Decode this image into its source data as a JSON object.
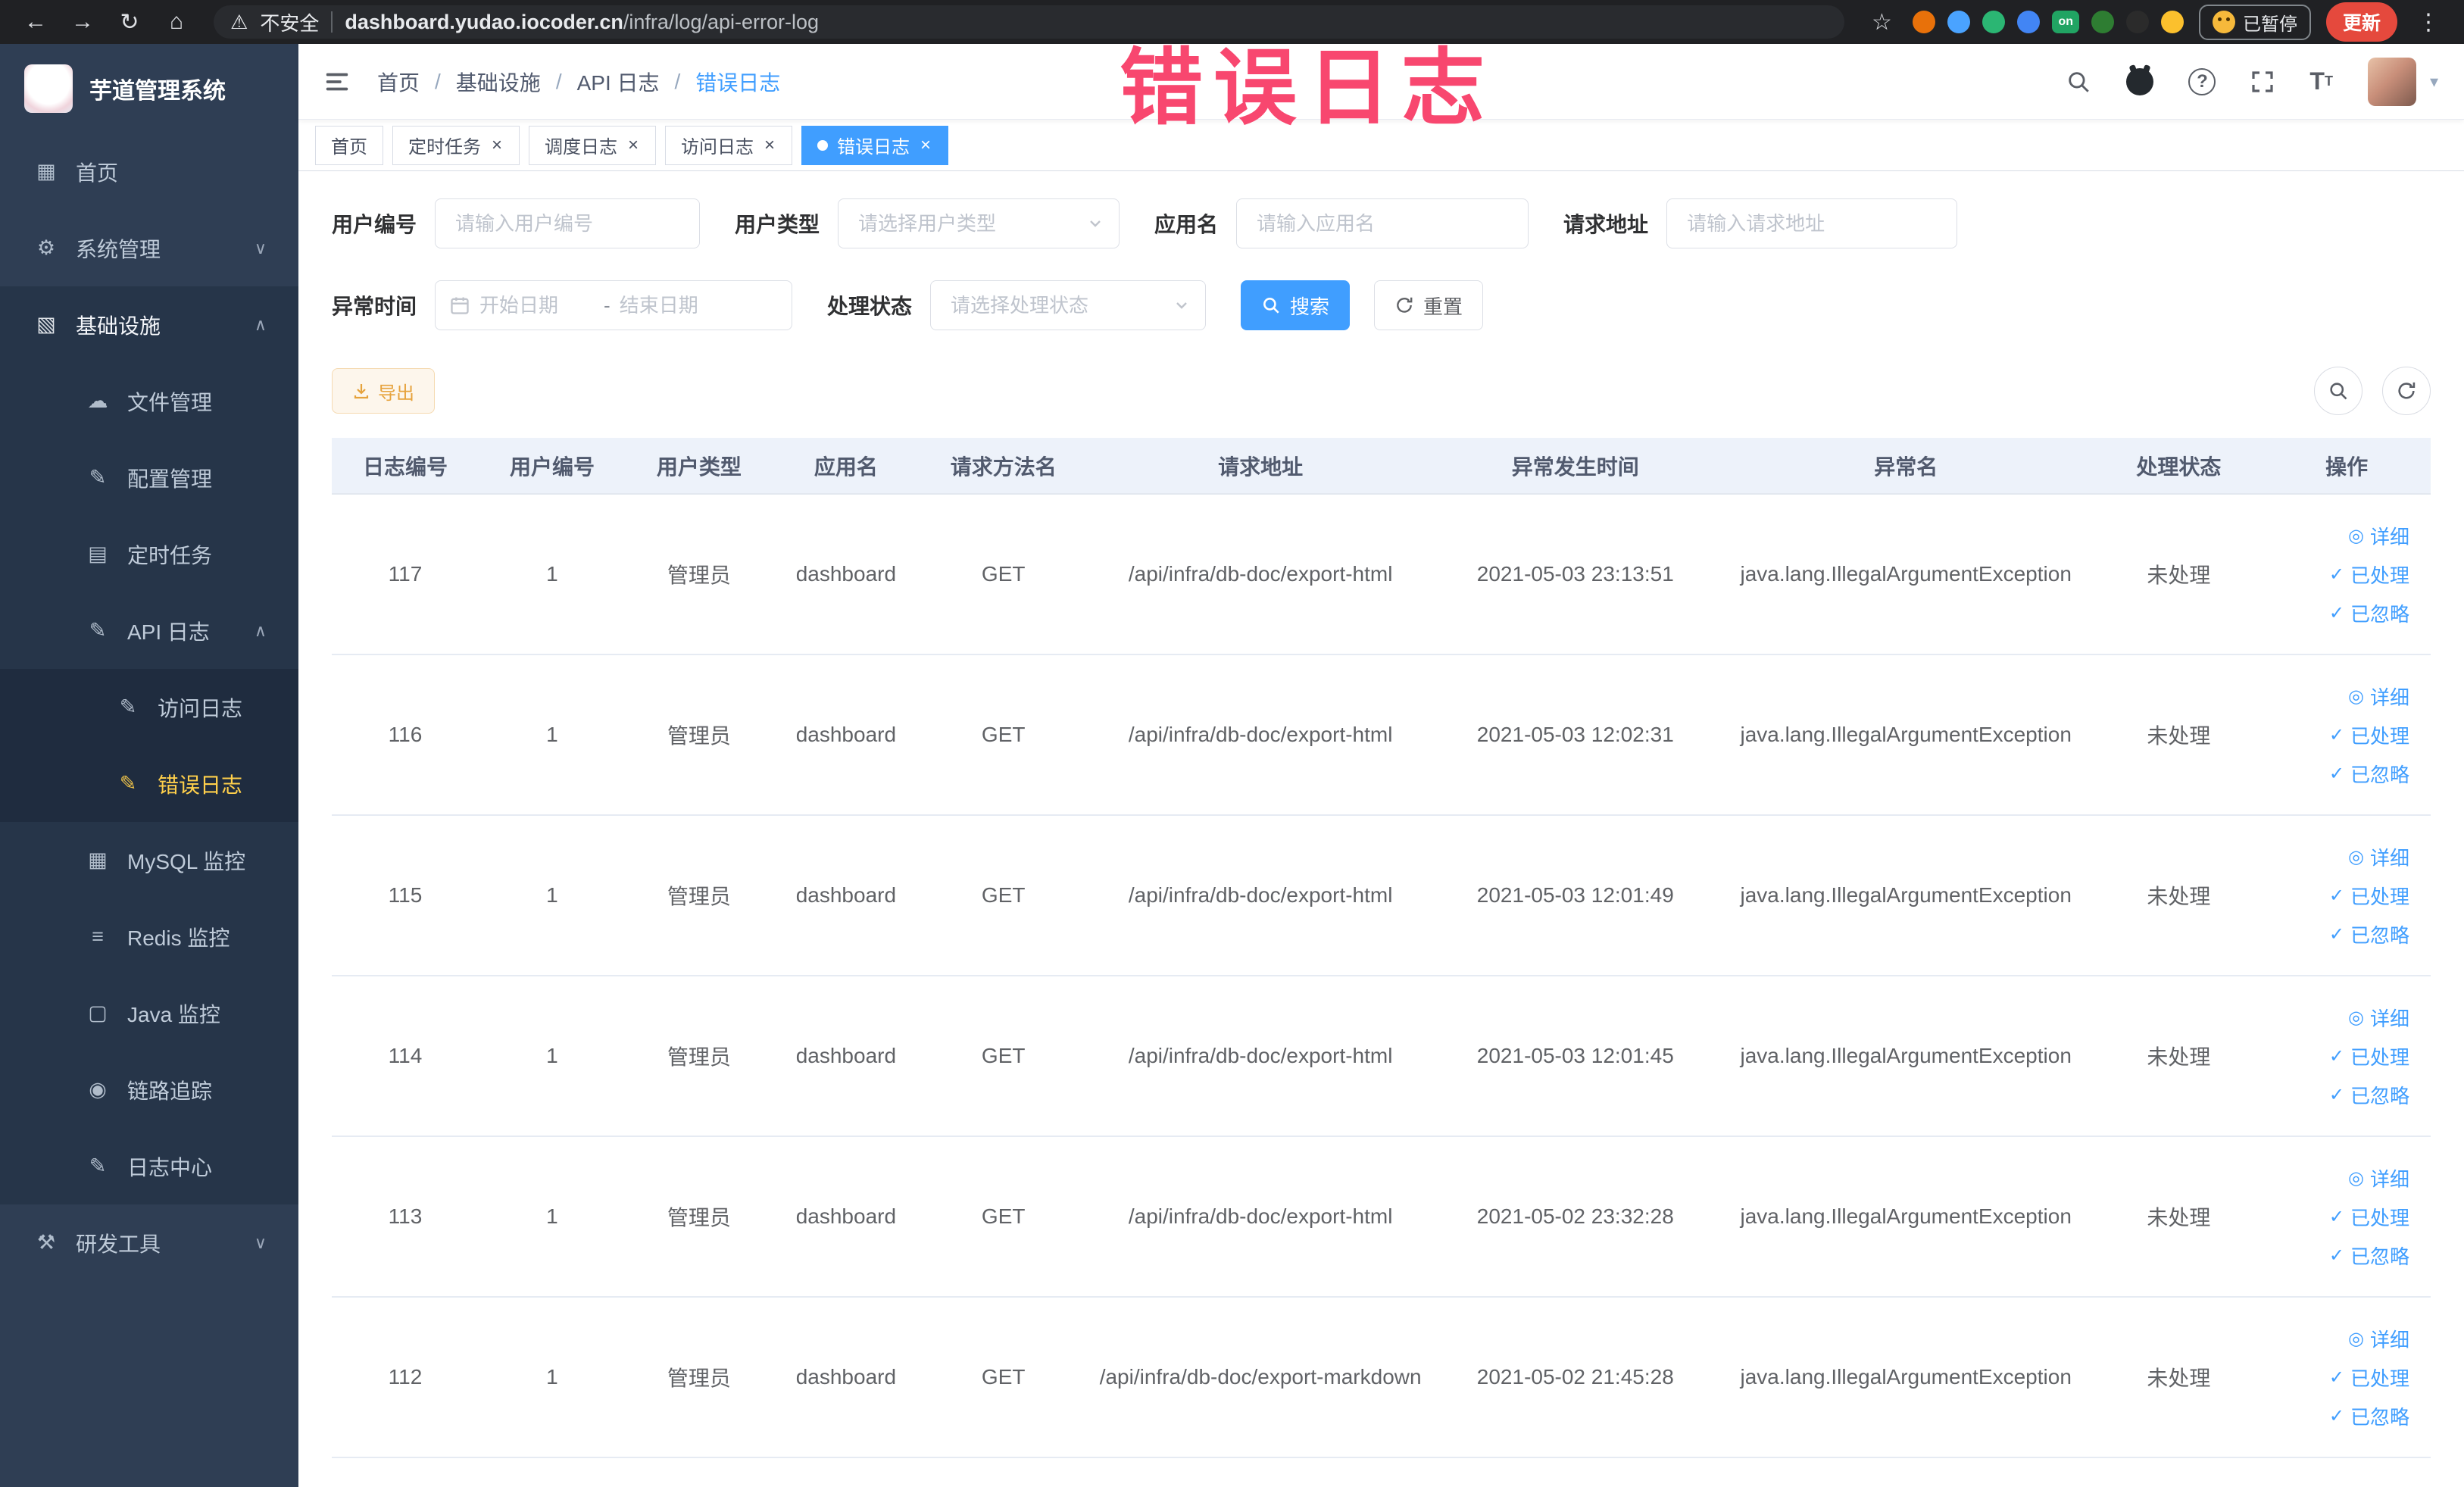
{
  "browser": {
    "security_label": "不安全",
    "url_domain": "dashboard.yudao.iocoder.cn",
    "url_path": "/infra/log/api-error-log",
    "paused_badge": "已暂停",
    "update_button": "更新",
    "icons": {
      "back": "←",
      "forward": "→",
      "reload": "↻",
      "home": "⌂",
      "warning": "⚠",
      "star": "☆",
      "menu": "⋮"
    },
    "extensions": [
      {
        "name": "extension-orange-icon",
        "color": "#e8710a"
      },
      {
        "name": "extension-drop-icon",
        "color": "#4aa3ff"
      },
      {
        "name": "extension-green-circle-icon",
        "color": "#2bb673"
      },
      {
        "name": "extension-blue-grid-icon",
        "color": "#4285f4"
      },
      {
        "name": "extension-on-badge-icon",
        "color": "#21a463",
        "label": "on"
      },
      {
        "name": "extension-tree-icon",
        "color": "#2e7d32"
      },
      {
        "name": "extension-paw-icon",
        "color": "#2b2b2b"
      },
      {
        "name": "extension-smiley-icon",
        "color": "#fbc02d"
      }
    ]
  },
  "overlay": {
    "title": "错误日志"
  },
  "sidebar": {
    "logo_title": "芋道管理系统",
    "items": [
      {
        "id": "home",
        "label": "首页",
        "icon": "dashboard-icon",
        "glyph": "▦",
        "level": 1
      },
      {
        "id": "system-management",
        "label": "系统管理",
        "icon": "gear-icon",
        "glyph": "⚙",
        "level": 1,
        "chevron": "down"
      },
      {
        "id": "infrastructure",
        "label": "基础设施",
        "icon": "infra-icon",
        "glyph": "▧",
        "level": 1,
        "chevron": "up",
        "expanded": true
      },
      {
        "id": "file-management",
        "label": "文件管理",
        "icon": "cloud-icon",
        "glyph": "☁",
        "level": 2
      },
      {
        "id": "config-management",
        "label": "配置管理",
        "icon": "edit-icon",
        "glyph": "✎",
        "level": 2
      },
      {
        "id": "scheduled-tasks",
        "label": "定时任务",
        "icon": "list-icon",
        "glyph": "▤",
        "level": 2
      },
      {
        "id": "api-log",
        "label": "API 日志",
        "icon": "edit-square-icon",
        "glyph": "✎",
        "level": 2,
        "chevron": "up"
      },
      {
        "id": "access-log",
        "label": "访问日志",
        "icon": "edit-square-icon",
        "glyph": "✎",
        "level": 3
      },
      {
        "id": "error-log",
        "label": "错误日志",
        "icon": "edit-square-icon",
        "glyph": "✎",
        "level": 3,
        "active": true
      },
      {
        "id": "mysql-monitor",
        "label": "MySQL 监控",
        "icon": "grid-icon",
        "glyph": "▦",
        "level": 2
      },
      {
        "id": "redis-monitor",
        "label": "Redis 监控",
        "icon": "layers-icon",
        "glyph": "≡",
        "level": 2
      },
      {
        "id": "java-monitor",
        "label": "Java 监控",
        "icon": "monitor-icon",
        "glyph": "▢",
        "level": 2
      },
      {
        "id": "trace",
        "label": "链路追踪",
        "icon": "eye-icon",
        "glyph": "◉",
        "level": 2
      },
      {
        "id": "log-center",
        "label": "日志中心",
        "icon": "edit-square-icon",
        "glyph": "✎",
        "level": 2
      },
      {
        "id": "dev-tools",
        "label": "研发工具",
        "icon": "tools-icon",
        "glyph": "⚒",
        "level": 1,
        "chevron": "down"
      }
    ]
  },
  "breadcrumb": [
    "首页",
    "基础设施",
    "API 日志",
    "错误日志"
  ],
  "tabs": [
    {
      "id": "home",
      "label": "首页",
      "closable": false,
      "active": false
    },
    {
      "id": "scheduled-tasks",
      "label": "定时任务",
      "closable": true,
      "active": false
    },
    {
      "id": "dispatch-log",
      "label": "调度日志",
      "closable": true,
      "active": false
    },
    {
      "id": "access-log",
      "label": "访问日志",
      "closable": true,
      "active": false
    },
    {
      "id": "error-log",
      "label": "错误日志",
      "closable": true,
      "active": true
    }
  ],
  "filters": {
    "user_id": {
      "label": "用户编号",
      "placeholder": "请输入用户编号"
    },
    "user_type": {
      "label": "用户类型",
      "placeholder": "请选择用户类型"
    },
    "app_name": {
      "label": "应用名",
      "placeholder": "请输入应用名"
    },
    "request_url": {
      "label": "请求地址",
      "placeholder": "请输入请求地址"
    },
    "exception_time": {
      "label": "异常时间",
      "start_placeholder": "开始日期",
      "end_placeholder": "结束日期",
      "separator": "-"
    },
    "process_status": {
      "label": "处理状态",
      "placeholder": "请选择处理状态"
    },
    "search_label": "搜索",
    "reset_label": "重置"
  },
  "toolbar": {
    "export_label": "导出"
  },
  "table": {
    "columns": [
      {
        "key": "id",
        "label": "日志编号"
      },
      {
        "key": "user_id",
        "label": "用户编号"
      },
      {
        "key": "user_type",
        "label": "用户类型"
      },
      {
        "key": "app",
        "label": "应用名"
      },
      {
        "key": "method",
        "label": "请求方法名"
      },
      {
        "key": "url",
        "label": "请求地址"
      },
      {
        "key": "time",
        "label": "异常发生时间"
      },
      {
        "key": "exception",
        "label": "异常名"
      },
      {
        "key": "status",
        "label": "处理状态"
      },
      {
        "key": "actions",
        "label": "操作"
      }
    ],
    "action_links": [
      {
        "id": "detail",
        "label": "详细",
        "icon": "view-icon",
        "glyph": "◎"
      },
      {
        "id": "processed",
        "label": "已处理",
        "icon": "check-icon",
        "glyph": "✓"
      },
      {
        "id": "ignored",
        "label": "已忽略",
        "icon": "check-icon",
        "glyph": "✓"
      }
    ],
    "rows": [
      {
        "id": "117",
        "user_id": "1",
        "user_type": "管理员",
        "app": "dashboard",
        "method": "GET",
        "url": "/api/infra/db-doc/export-html",
        "time": "2021-05-03 23:13:51",
        "exception": "java.lang.IllegalArgumentException",
        "status": "未处理"
      },
      {
        "id": "116",
        "user_id": "1",
        "user_type": "管理员",
        "app": "dashboard",
        "method": "GET",
        "url": "/api/infra/db-doc/export-html",
        "time": "2021-05-03 12:02:31",
        "exception": "java.lang.IllegalArgumentException",
        "status": "未处理"
      },
      {
        "id": "115",
        "user_id": "1",
        "user_type": "管理员",
        "app": "dashboard",
        "method": "GET",
        "url": "/api/infra/db-doc/export-html",
        "time": "2021-05-03 12:01:49",
        "exception": "java.lang.IllegalArgumentException",
        "status": "未处理"
      },
      {
        "id": "114",
        "user_id": "1",
        "user_type": "管理员",
        "app": "dashboard",
        "method": "GET",
        "url": "/api/infra/db-doc/export-html",
        "time": "2021-05-03 12:01:45",
        "exception": "java.lang.IllegalArgumentException",
        "status": "未处理"
      },
      {
        "id": "113",
        "user_id": "1",
        "user_type": "管理员",
        "app": "dashboard",
        "method": "GET",
        "url": "/api/infra/db-doc/export-html",
        "time": "2021-05-02 23:32:28",
        "exception": "java.lang.IllegalArgumentException",
        "status": "未处理"
      },
      {
        "id": "112",
        "user_id": "1",
        "user_type": "管理员",
        "app": "dashboard",
        "method": "GET",
        "url": "/api/infra/db-doc/export-markdown",
        "time": "2021-05-02 21:45:28",
        "exception": "java.lang.IllegalArgumentException",
        "status": "未处理"
      }
    ]
  }
}
